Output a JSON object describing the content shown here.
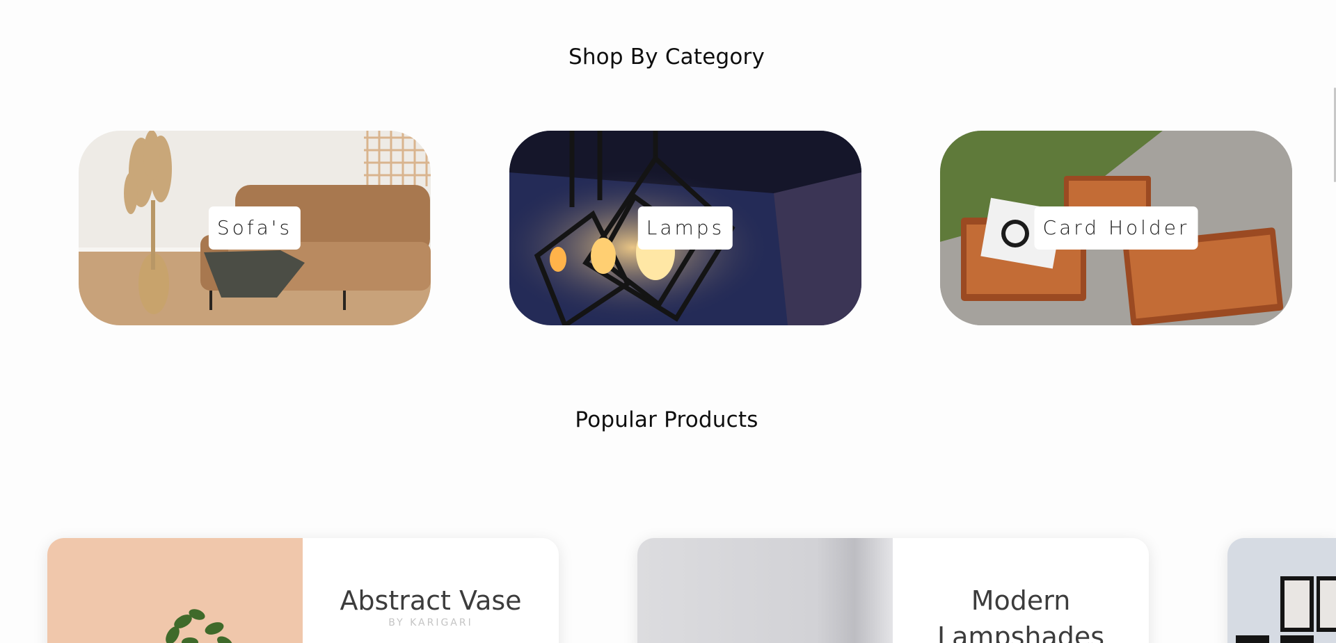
{
  "sections": {
    "category_title": "Shop By Category",
    "popular_title": "Popular Products"
  },
  "categories": [
    {
      "label": "Sofa's"
    },
    {
      "label": "Lamps"
    },
    {
      "label": "Card Holder"
    }
  ],
  "products": [
    {
      "name": "Abstract Vase",
      "brand": "BY KARIGARI"
    },
    {
      "name": "Modern Lampshades",
      "brand": ""
    }
  ],
  "colors": {
    "background": "#fdfdfd",
    "title_text": "#0e0e0e",
    "product_name": "#3c3c3c",
    "product_brand": "#c4c4c4"
  }
}
